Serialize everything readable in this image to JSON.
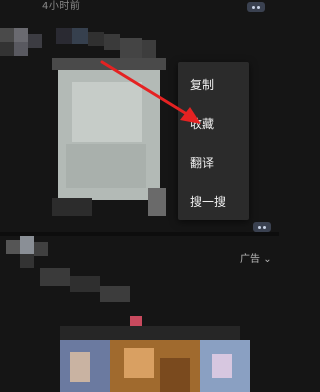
{
  "feed": {
    "timestamp": "4小时前",
    "ad_label": "广告"
  },
  "context_menu": {
    "items": [
      {
        "label": "复制"
      },
      {
        "label": "收藏"
      },
      {
        "label": "翻译"
      },
      {
        "label": "搜一搜"
      }
    ]
  },
  "icons": {
    "more": "more-dots-icon",
    "annotation": "red-arrow-icon",
    "ad_chevron": "chevron-down-icon"
  },
  "colors": {
    "background": "#151515",
    "menu_background": "#2b2b2b",
    "menu_text": "#f0f0f0",
    "arrow": "#e52222",
    "more_button": "#3a4150"
  }
}
